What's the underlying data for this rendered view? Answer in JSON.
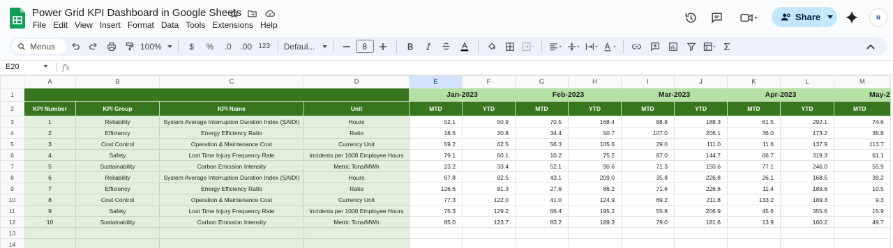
{
  "doc": {
    "title": "Power Grid KPI Dashboard in Google Sheets"
  },
  "menu": [
    "File",
    "Edit",
    "View",
    "Insert",
    "Format",
    "Data",
    "Tools",
    "Extensions",
    "Help"
  ],
  "share": {
    "label": "Share"
  },
  "avatar": {
    "text": "N"
  },
  "toolbar": {
    "menus_label": "Menus",
    "zoom": "100%",
    "currency": "$",
    "percent": "%",
    "dec_decrease": ".0",
    "dec_increase": ".00",
    "number_format": "123",
    "font_name": "Defaul...",
    "font_size": "8"
  },
  "formula_bar": {
    "cell_ref": "E20",
    "fx": "fx"
  },
  "columns": [
    "A",
    "B",
    "C",
    "D",
    "E",
    "F",
    "G",
    "H",
    "I",
    "J",
    "K",
    "L",
    "M"
  ],
  "row_numbers": [
    "1",
    "2",
    "3",
    "4",
    "5",
    "6",
    "7",
    "8",
    "9",
    "10",
    "11",
    "12",
    "13",
    "14"
  ],
  "months": [
    "Jan-2023",
    "Feb-2023",
    "Mar-2023",
    "Apr-2023",
    "May-2"
  ],
  "headers": {
    "kpi_number": "KPI Number",
    "kpi_group": "KPI Group",
    "kpi_name": "KPI Name",
    "unit": "Unit",
    "mtd": "MTD",
    "ytd": "YTD"
  },
  "rows": [
    {
      "num": "1",
      "group": "Reliability",
      "name": "System Average Interruption Duration Index (SAIDI)",
      "unit": "Hours",
      "vals": [
        "52.1",
        "50.9",
        "70.5",
        "168.4",
        "88.8",
        "188.3",
        "61.5",
        "292.1",
        "74.6"
      ]
    },
    {
      "num": "2",
      "group": "Efficiency",
      "name": "Energy Efficiency Ratio",
      "unit": "Ratio",
      "vals": [
        "18.6",
        "20.8",
        "34.4",
        "50.7",
        "107.0",
        "206.1",
        "36.0",
        "173.2",
        "36.8"
      ]
    },
    {
      "num": "3",
      "group": "Cost Control",
      "name": "Operation & Maintenance Cost",
      "unit": "Currency Unit",
      "vals": [
        "59.2",
        "62.5",
        "56.3",
        "105.6",
        "29.0",
        "111.0",
        "11.6",
        "137.9",
        "113.7"
      ]
    },
    {
      "num": "4",
      "group": "Safety",
      "name": "Lost Time Injury Frequency Rate",
      "unit": "Incidents per 1000 Employee Hours",
      "vals": [
        "79.1",
        "60.1",
        "10.2",
        "75.2",
        "87.0",
        "144.7",
        "66.7",
        "319.3",
        "61.1"
      ]
    },
    {
      "num": "5",
      "group": "Sustainability",
      "name": "Carbon Emission Intensity",
      "unit": "Metric Tons/MWh",
      "vals": [
        "23.2",
        "33.4",
        "52.1",
        "90.6",
        "71.3",
        "150.6",
        "77.1",
        "246.0",
        "55.9"
      ]
    },
    {
      "num": "6",
      "group": "Reliability",
      "name": "System Average Interruption Duration Index (SAIDI)",
      "unit": "Hours",
      "vals": [
        "67.8",
        "92.5",
        "43.1",
        "209.0",
        "35.8",
        "226.8",
        "26.1",
        "168.5",
        "39.2"
      ]
    },
    {
      "num": "7",
      "group": "Efficiency",
      "name": "Energy Efficiency Ratio",
      "unit": "Ratio",
      "vals": [
        "126.6",
        "81.3",
        "27.6",
        "86.2",
        "71.6",
        "226.6",
        "11.4",
        "189.6",
        "10.5"
      ]
    },
    {
      "num": "8",
      "group": "Cost Control",
      "name": "Operation & Maintenance Cost",
      "unit": "Currency Unit",
      "vals": [
        "77.3",
        "122.0",
        "41.0",
        "124.9",
        "69.2",
        "211.8",
        "133.2",
        "189.3",
        "9.3"
      ]
    },
    {
      "num": "9",
      "group": "Safety",
      "name": "Lost Time Injury Frequency Rate",
      "unit": "Incidents per 1000 Employee Hours",
      "vals": [
        "75.3",
        "129.2",
        "66.4",
        "195.2",
        "55.8",
        "206.9",
        "45.6",
        "355.6",
        "15.9"
      ]
    },
    {
      "num": "10",
      "group": "Sustainability",
      "name": "Carbon Emission Intensity",
      "unit": "Metric Tons/MWh",
      "vals": [
        "85.0",
        "123.7",
        "83.2",
        "189.3",
        "79.0",
        "181.6",
        "13.9",
        "160.2",
        "49.7"
      ]
    }
  ],
  "colors": {
    "dark_green": "#38761d",
    "light_green": "#b6e1a4",
    "pale_green": "#e2efda",
    "share_bg": "#c2e7ff",
    "selected_col": "#d3e3fd"
  }
}
